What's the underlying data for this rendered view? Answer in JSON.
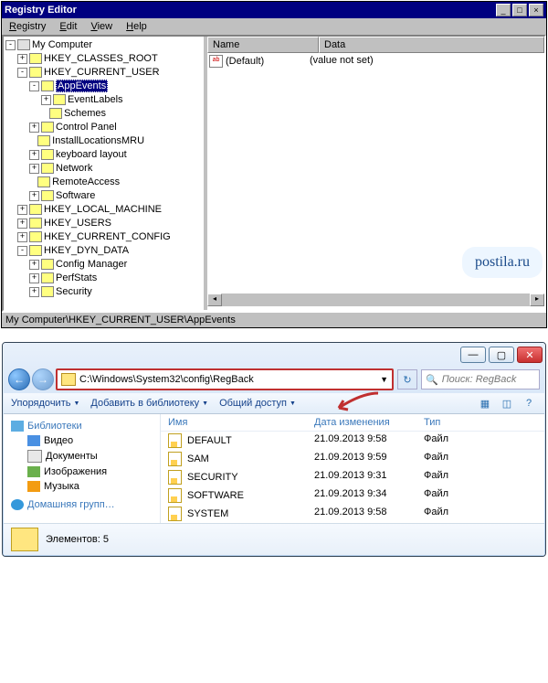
{
  "watermark": "postila.ru",
  "regedit": {
    "title": "Registry Editor",
    "menu": [
      "Registry",
      "Edit",
      "View",
      "Help"
    ],
    "tree": {
      "root": "My Computer",
      "hkcr": "HKEY_CLASSES_ROOT",
      "hkcu": "HKEY_CURRENT_USER",
      "appevents": "AppEvents",
      "eventlabels": "EventLabels",
      "schemes": "Schemes",
      "controlpanel": "Control Panel",
      "installloc": "InstallLocationsMRU",
      "keyboard": "keyboard layout",
      "network": "Network",
      "remote": "RemoteAccess",
      "software": "Software",
      "hklm": "HKEY_LOCAL_MACHINE",
      "hku": "HKEY_USERS",
      "hkcc": "HKEY_CURRENT_CONFIG",
      "hkdd": "HKEY_DYN_DATA",
      "configmgr": "Config Manager",
      "perfstats": "PerfStats",
      "security": "Security"
    },
    "cols": {
      "name": "Name",
      "data": "Data"
    },
    "values": {
      "default": "(Default)",
      "notset": "(value not set)"
    },
    "status": "My Computer\\HKEY_CURRENT_USER\\AppEvents"
  },
  "explorer": {
    "path": "C:\\Windows\\System32\\config\\RegBack",
    "search_ph": "Поиск: RegBack",
    "toolbar": {
      "organize": "Упорядочить",
      "include": "Добавить в библиотеку",
      "share": "Общий доступ"
    },
    "nav": {
      "lib": "Библиотеки",
      "video": "Видео",
      "docs": "Документы",
      "images": "Изображения",
      "music": "Музыка",
      "homegroup": "Домашняя групп…"
    },
    "cols": {
      "name": "Имя",
      "date": "Дата изменения",
      "type": "Тип"
    },
    "files": [
      {
        "name": "DEFAULT",
        "date": "21.09.2013 9:58",
        "type": "Файл"
      },
      {
        "name": "SAM",
        "date": "21.09.2013 9:59",
        "type": "Файл"
      },
      {
        "name": "SECURITY",
        "date": "21.09.2013 9:31",
        "type": "Файл"
      },
      {
        "name": "SOFTWARE",
        "date": "21.09.2013 9:34",
        "type": "Файл"
      },
      {
        "name": "SYSTEM",
        "date": "21.09.2013 9:58",
        "type": "Файл"
      }
    ],
    "status": "Элементов: 5"
  }
}
